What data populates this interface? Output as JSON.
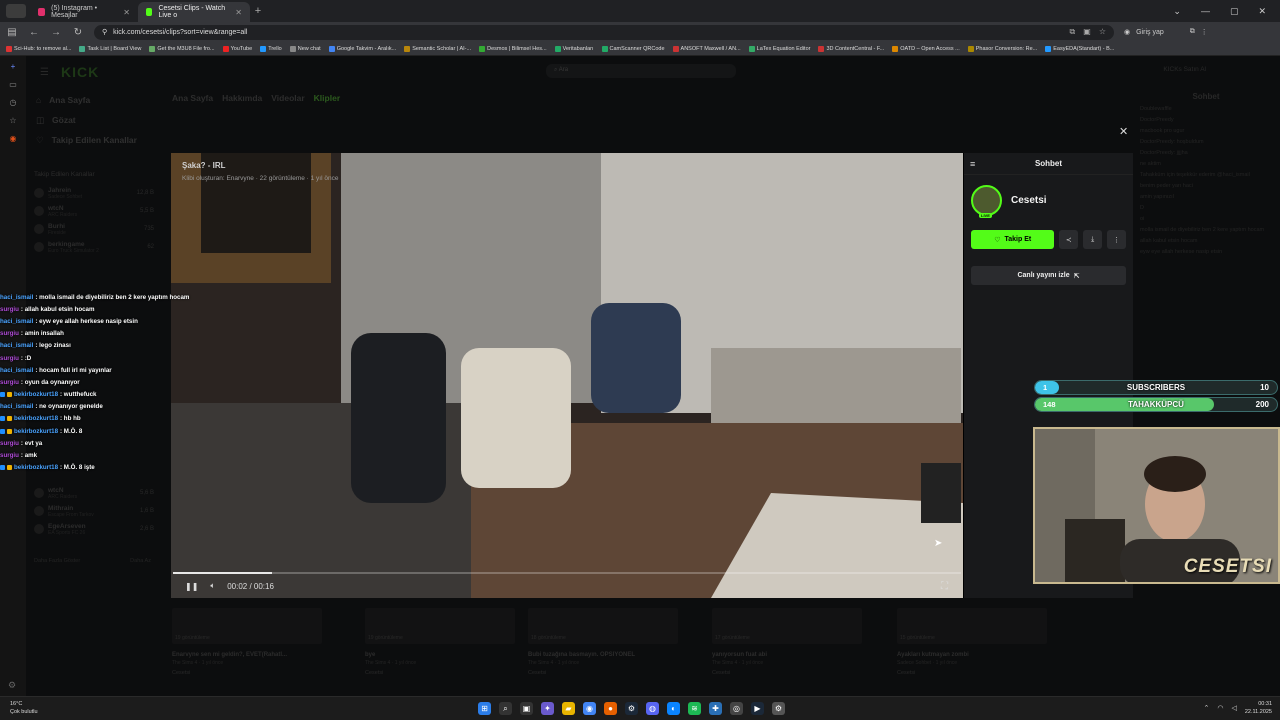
{
  "browser": {
    "tabs": [
      {
        "label": "(5) Instagram • Mesajlar",
        "color": "#e1306c"
      },
      {
        "label": "Cesetsi Clips - Watch Live o",
        "color": "#53fc18"
      }
    ],
    "url": "kick.com/cesetsi/clips?sort=view&range=all",
    "profile_label": "Giriş yap",
    "bookmarks": [
      "Sci-Hub: to remove al...",
      "Task List | Board View",
      "Get the M3U8 File fro...",
      "YouTube",
      "Trello",
      "New chat",
      "Google Takvim - Aralık...",
      "Semantic Scholar | AI-...",
      "Desmos | Bilimsel Hes...",
      "Veritabanları",
      "CamScanner QRCode",
      "ANSOFT Maxwell / AN...",
      "LaTex Equation Editor",
      "3D ContentCentral - F...",
      "OATD – Open Access ...",
      "Phasor Conversion: Re...",
      "EasyEDA(Standart) - B..."
    ],
    "bookmark_colors": [
      "#d33",
      "#4a8",
      "#6a6",
      "#e22",
      "#29f",
      "#888",
      "#4285f4",
      "#b8860b",
      "#3a3",
      "#2a6",
      "#2a6",
      "#c33",
      "#3a6",
      "#c33",
      "#d80",
      "#a80",
      "#29f"
    ]
  },
  "kick": {
    "logo": "KICK",
    "search_placeholder": "Ara",
    "buy_label": "KICKs Satın Al",
    "nav": [
      {
        "label": "Ana Sayfa",
        "icon": "home-icon",
        "glyph": "⌂"
      },
      {
        "label": "Gözat",
        "icon": "browse-icon",
        "glyph": "◫"
      },
      {
        "label": "Takip Edilen Kanallar",
        "icon": "heart-icon",
        "glyph": "♡"
      }
    ],
    "followed_header": "Takip Edilen Kanallar",
    "channels": [
      {
        "name": "Jahrein",
        "sub": "Sadece Sohbet",
        "viewers": "12,8 B"
      },
      {
        "name": "wtcN",
        "sub": "ARC Raiders",
        "viewers": "5,5 B"
      },
      {
        "name": "Burhi",
        "sub": "Fireside",
        "viewers": "735"
      },
      {
        "name": "berkingame",
        "sub": "Euro Truck Simulator 2",
        "viewers": "62"
      }
    ],
    "channels_lower": [
      {
        "name": "wtcN",
        "sub": "ARC Raiders",
        "viewers": "5,6 B"
      },
      {
        "name": "Mithrain",
        "sub": "Escape From Tarkov",
        "viewers": "1,6 B"
      },
      {
        "name": "EgeArseven",
        "sub": "EA Sports FC 26",
        "viewers": "2,6 B"
      }
    ],
    "show_more": "Daha Fazla Göster",
    "show_less": "Daha Az",
    "page_tabs": [
      "Ana Sayfa",
      "Hakkımda",
      "Videolar",
      "Klipler"
    ],
    "clips": [
      {
        "views": "19 görüntüleme",
        "title": "Enarvyne sen mi geldin?, EVET(Rahatl...",
        "meta": "The Sims 4 · 1 yıl önce",
        "author": "Cesetsi"
      },
      {
        "views": "19 görüntüleme",
        "title": "bye",
        "meta": "The Sims 4 · 1 yıl önce",
        "author": "Cesetsi"
      },
      {
        "views": "18 görüntüleme",
        "title": "Bubi tuzağına basmayın. OPSIYONEL",
        "meta": "The Sims 4 · 1 yıl önce",
        "author": "Cesetsi"
      },
      {
        "views": "17 görüntüleme",
        "title": "yanıyorsun fuat abi",
        "meta": "The Sims 4 · 1 yıl önce",
        "author": "Cesetsi"
      },
      {
        "views": "15 görüntüleme",
        "title": "Ayakları kutmayan zombi",
        "meta": "Sadece Sohbet · 1 yıl önce",
        "author": "Cesetsi"
      }
    ],
    "bg_chat_title": "Sohbet",
    "bg_chat": [
      "Doublewaffle",
      "DoctorPreedy",
      "macbook pro ugur",
      "DoctorPreedy: hoşbuldum",
      "DoctorPreedy: jjjjha",
      "ne aktim",
      "Tahakküm için teşekkür ederim @haci_ismail",
      "benim peder yarı haci",
      "amin yapınızıl",
      "D",
      "oi",
      "molla ismail de diyebiliriz ben 2 kere yaptım hocam",
      "allah kabul etsin hocam",
      "eyw eye allah herkese nasip etsin"
    ]
  },
  "modal": {
    "title": "Şaka? - IRL",
    "meta": "Klibi oluşturan: Enarvyne · 22 görüntüleme · 1 yıl önce",
    "time": "00:02 / 00:16",
    "progress": 0.125,
    "side_title": "Sohbet",
    "channel_name": "Cesetsi",
    "live_badge": "LIVE",
    "follow_label": "Takip Et",
    "watch_live_label": "Canlı yayını izle"
  },
  "overlay": {
    "chat": [
      {
        "user": "haci_ismail",
        "msg": ": molla ismail de diyebiliriz ben 2 kere yaptım hocam",
        "purple": false,
        "badges": 0
      },
      {
        "user": "surgiu",
        "msg": ": allah kabul etsin hocam",
        "purple": true,
        "badges": 0
      },
      {
        "user": "haci_ismail",
        "msg": ": eyw eye allah herkese nasip etsin",
        "purple": false,
        "badges": 0
      },
      {
        "user": "surgiu",
        "msg": ": amin insallah",
        "purple": true,
        "badges": 0
      },
      {
        "user": "haci_ismail",
        "msg": ": lego zinası",
        "purple": false,
        "badges": 0
      },
      {
        "user": "surgiu",
        "msg": ": :D",
        "purple": true,
        "badges": 0
      },
      {
        "user": "haci_ismail",
        "msg": ": hocam full irl mi yayınlar",
        "purple": false,
        "badges": 0
      },
      {
        "user": "surgiu",
        "msg": ": oyun da oynanıyor",
        "purple": true,
        "badges": 0
      },
      {
        "user": "bekirbozkurt18",
        "msg": ": wutthefuck",
        "purple": false,
        "badges": 2
      },
      {
        "user": "haci_ismail",
        "msg": ": ne oynanıyor genelde",
        "purple": false,
        "badges": 0
      },
      {
        "user": "bekirbozkurt18",
        "msg": ": hb hb",
        "purple": false,
        "badges": 2
      },
      {
        "user": "bekirbozkurt18",
        "msg": ": M.Ö. 8",
        "purple": false,
        "badges": 2
      },
      {
        "user": "surgiu",
        "msg": ": evt ya",
        "purple": true,
        "badges": 0
      },
      {
        "user": "surgiu",
        "msg": ": amk",
        "purple": true,
        "badges": 0
      },
      {
        "user": "bekirbozkurt18",
        "msg": ": M.Ö. 8 işte",
        "purple": false,
        "badges": 2
      }
    ],
    "bars": [
      {
        "label": "SUBSCRIBERS",
        "current": "1",
        "goal": "10",
        "fraction": 0.1,
        "color": "#3ec3e8"
      },
      {
        "label": "TAHAKKÜPCÜ",
        "current": "148",
        "goal": "200",
        "fraction": 0.74,
        "color": "#58c76a"
      }
    ],
    "cam_watermark": "CESETSI"
  },
  "taskbar": {
    "temp": "16°C",
    "weather": "Çok bulutlu",
    "time": "00:31",
    "date": "22.11.2025",
    "apps": [
      {
        "icon": "windows-start-icon",
        "glyph": "⊞",
        "color": "#2b7de9"
      },
      {
        "icon": "search-icon",
        "glyph": "⌕",
        "color": "#333"
      },
      {
        "icon": "task-view-icon",
        "glyph": "▣",
        "color": "#333"
      },
      {
        "icon": "copilot-icon",
        "glyph": "✦",
        "color": "#6a5acd"
      },
      {
        "icon": "file-explorer-icon",
        "glyph": "▰",
        "color": "#e8b400"
      },
      {
        "icon": "chrome-icon",
        "glyph": "◉",
        "color": "#4285f4"
      },
      {
        "icon": "firefox-icon",
        "glyph": "●",
        "color": "#e66000"
      },
      {
        "icon": "steam-icon",
        "glyph": "⚙",
        "color": "#1b2838"
      },
      {
        "icon": "discord-icon",
        "glyph": "◍",
        "color": "#5865f2"
      },
      {
        "icon": "edge-icon",
        "glyph": "◐",
        "color": "#0a84ff"
      },
      {
        "icon": "spotify-icon",
        "glyph": "≋",
        "color": "#1db954"
      },
      {
        "icon": "network-app-icon",
        "glyph": "✚",
        "color": "#2a6fb5"
      },
      {
        "icon": "obs-icon",
        "glyph": "◎",
        "color": "#444"
      },
      {
        "icon": "steam-taskbar-icon",
        "glyph": "▶",
        "color": "#1b2838"
      },
      {
        "icon": "settings-icon",
        "glyph": "⚙",
        "color": "#555"
      }
    ]
  }
}
